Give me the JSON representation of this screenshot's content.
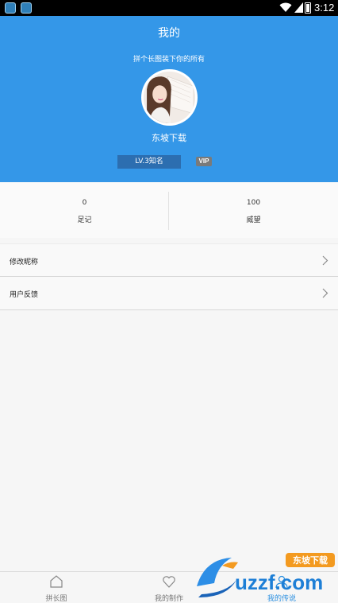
{
  "status_bar": {
    "time": "3:12"
  },
  "header": {
    "title": "我的",
    "slogan": "拼个长图装下你的所有",
    "username": "东坡下载",
    "level": "LV.3知名",
    "vip": "VIP"
  },
  "stats": [
    {
      "value": "0",
      "label": "足记"
    },
    {
      "value": "100",
      "label": "威望"
    }
  ],
  "menu": [
    {
      "label": "修改昵称"
    },
    {
      "label": "用户反馈"
    }
  ],
  "tabs": [
    {
      "label": "拼长图",
      "icon": "home-icon"
    },
    {
      "label": "我的制作",
      "icon": "heart-icon"
    },
    {
      "label": "我的传说",
      "icon": "user-icon",
      "active": true
    }
  ],
  "watermark": {
    "text": "uzzf.com",
    "badge": "东坡下载"
  },
  "colors": {
    "header": "#3497e8",
    "active_tab": "#2a8fe0"
  }
}
